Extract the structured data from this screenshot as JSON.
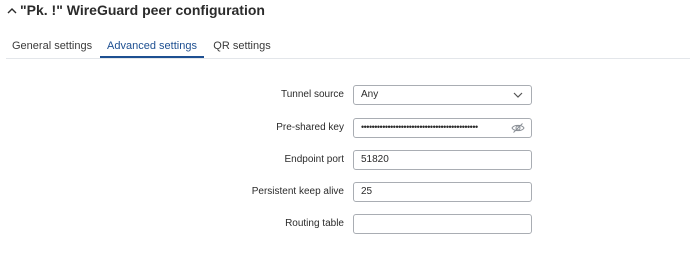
{
  "header": {
    "title": "\"Pk.          !\" WireGuard peer configuration"
  },
  "tabs": [
    {
      "label": "General settings",
      "active": false
    },
    {
      "label": "Advanced settings",
      "active": true
    },
    {
      "label": "QR settings",
      "active": false
    }
  ],
  "form": {
    "tunnel_source": {
      "label": "Tunnel source",
      "value": "Any"
    },
    "pre_shared_key": {
      "label": "Pre-shared key",
      "value": "••••••••••••••••••••••••••••••••••••••••••••"
    },
    "endpoint_port": {
      "label": "Endpoint port",
      "value": "51820"
    },
    "persistent_keep_alive": {
      "label": "Persistent keep alive",
      "value": "25"
    },
    "routing_table": {
      "label": "Routing table",
      "value": ""
    }
  },
  "colors": {
    "accent": "#1d4f91",
    "border": "#a9adb3",
    "text": "#2b2b2b"
  },
  "icons": {
    "collapse": "chevron-up-icon",
    "select": "chevron-down-icon",
    "visibility": "eye-slash-icon"
  }
}
